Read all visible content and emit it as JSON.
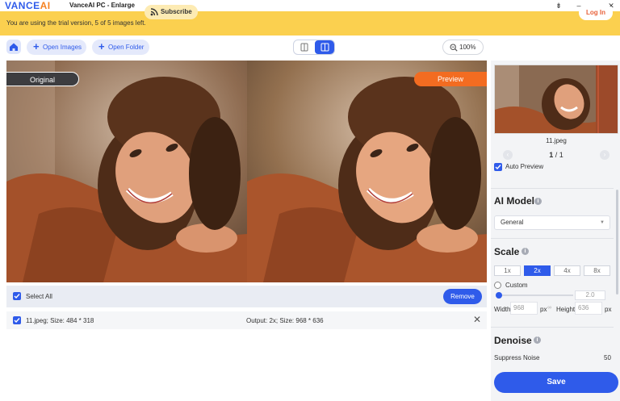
{
  "titlebar": {
    "logo_main": "VANCE",
    "logo_accent": "AI",
    "title": "VanceAI PC - Enlarge",
    "controls": [
      "⇟",
      "–",
      "▭",
      "✕"
    ]
  },
  "trial": {
    "text": "You are using the trial version, 5 of 5 images left.",
    "subscribe_label": "Subscribe",
    "login_label": "Log In"
  },
  "toolbar": {
    "open_images_label": "Open Images",
    "open_folder_label": "Open Folder",
    "zoom_label": "100%"
  },
  "viewer": {
    "original_label": "Original",
    "preview_label": "Preview"
  },
  "filelist": {
    "select_all_label": "Select All",
    "remove_label": "Remove",
    "file_info": "11.jpeg; Size: 484 * 318",
    "file_output": "Output: 2x; Size: 968 * 636",
    "close_glyph": "✕"
  },
  "panel": {
    "thumb_name": "11.jpeg",
    "page_current": "1",
    "page_sep": " / ",
    "page_total": "1",
    "prev_glyph": "‹",
    "next_glyph": "›",
    "auto_preview_label": "Auto Preview",
    "ai_model_title": "AI Model",
    "ai_model_value": "General",
    "scale_title": "Scale",
    "scale_options": [
      "1x",
      "2x",
      "4x",
      "8x"
    ],
    "scale_selected": "2x",
    "custom_label": "Custom",
    "custom_value": "2.0",
    "width_label": "Width",
    "width_value": "968",
    "width_unit": "px",
    "height_label": "Height",
    "height_value": "636",
    "height_unit": "px",
    "denoise_title": "Denoise",
    "suppress_label": "Suppress Noise",
    "suppress_value": "50",
    "save_label": "Save"
  },
  "colors": {
    "accent": "#2f5bea",
    "trial_bar": "#fbd04f",
    "preview_tag": "#f36c21",
    "login_text": "#e8613a"
  }
}
